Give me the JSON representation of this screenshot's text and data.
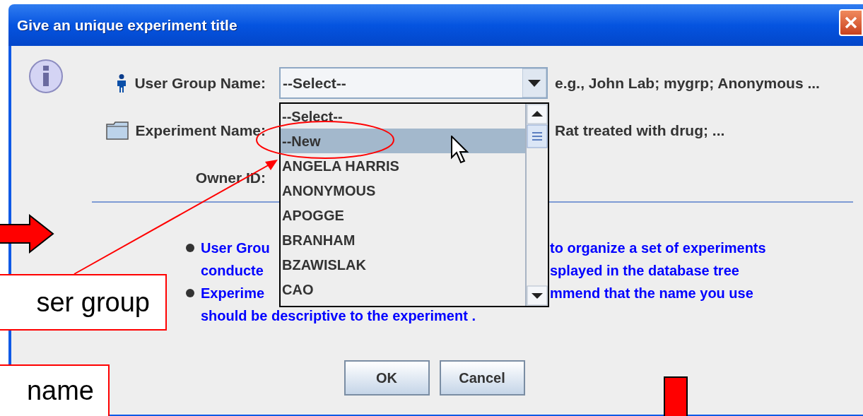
{
  "window": {
    "title": "Give an unique experiment title"
  },
  "fields": [
    {
      "kind": "combo",
      "label": "User Group Name:",
      "value": "--Select--",
      "hint": "e.g., John Lab; mygrp; Anonymous ..."
    },
    {
      "kind": "text",
      "label": "Experiment Name:",
      "hint": "Rat treated with drug; ..."
    },
    {
      "kind": "text",
      "label": "Owner ID:"
    }
  ],
  "dropdown": {
    "items": [
      {
        "label": "--Select--",
        "selected": false
      },
      {
        "label": "--New",
        "selected": true
      },
      {
        "label": "ANGELA HARRIS",
        "selected": false
      },
      {
        "label": "ANONYMOUS",
        "selected": false
      },
      {
        "label": "APOGGE",
        "selected": false
      },
      {
        "label": "BRANHAM",
        "selected": false
      },
      {
        "label": "BZAWISLAK",
        "selected": false
      },
      {
        "label": "CAO",
        "selected": false
      }
    ]
  },
  "notes": [
    {
      "bullet": true,
      "left": "User Grou",
      "right": "to organize a set of experiments"
    },
    {
      "bullet": false,
      "left": "conducte",
      "right": "splayed in the database tree"
    },
    {
      "bullet": true,
      "left": "Experime",
      "right": "mmend that the name you use"
    },
    {
      "bullet": false,
      "left": "should be descriptive to the experiment ."
    }
  ],
  "buttons": [
    "OK",
    "Cancel"
  ],
  "annotations": {
    "callouts": [
      "ser group",
      "name"
    ]
  }
}
